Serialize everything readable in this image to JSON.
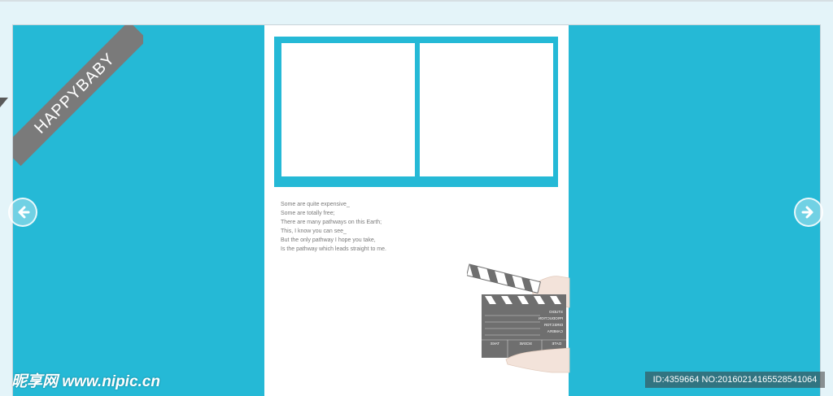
{
  "corner_ribbon": {
    "text": "HAPPYBABY"
  },
  "poem": {
    "lines": [
      "Some are quite expensive_",
      "Some are totally free;",
      "There are many pathways on this Earth;",
      "This, I know you can see_",
      "But the only pathway I hope you take,",
      "Is the pathway which leads straight to me."
    ]
  },
  "clapperboard": {
    "rows": [
      "STUDIO",
      "PRODUCTION",
      "DIRECTOR",
      "CAMERA"
    ],
    "cells": [
      "TAKE",
      "SCENE",
      "DATE"
    ]
  },
  "watermark": {
    "text": "昵享网 www.nipic.cn"
  },
  "image_id": {
    "text": "ID:4359664 NO:20160214165528541064"
  },
  "nav": {
    "prev_icon": "arrow-left-icon",
    "next_icon": "arrow-right-icon"
  },
  "colors": {
    "accent": "#25b9d6",
    "ribbon": "#7a7a7a",
    "background": "#e4f4f9"
  }
}
